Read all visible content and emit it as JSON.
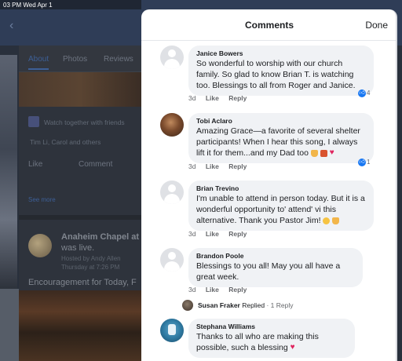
{
  "status_bar": {
    "time": "03 PM",
    "date": "Wed Apr 1"
  },
  "background": {
    "tabs": [
      "About",
      "Photos",
      "Reviews"
    ],
    "row1": "Watch together with friends",
    "row2": "Tim Li, Carol and others",
    "actions": {
      "like": "Like",
      "comment": "Comment"
    },
    "see_more": "See more",
    "post": {
      "title": "Anaheim Chapel at",
      "subtitle": "was live.",
      "meta1": "Hosted by Andy Allen",
      "meta2": "Thursday at 7:26 PM",
      "body": "Encouragement for Today, F"
    }
  },
  "sheet": {
    "title": "Comments",
    "done_label": "Done"
  },
  "comment_actions": {
    "like": "Like",
    "reply": "Reply"
  },
  "comments": [
    {
      "author": "Janice Bowers",
      "text": "So wonderful to worship with our church family. So glad to know Brian T. is watching too. Blessings to all from Roger and Janice.",
      "time": "3d",
      "reactions": "4"
    },
    {
      "author": "Tobi Aclaro",
      "text": "Amazing Grace—a favorite of several shelter participants! When I hear this song, I always lift it for them...and my Dad too",
      "time": "3d",
      "reactions": "1"
    },
    {
      "author": "Brian Trevino",
      "text": "I'm unable to attend in person today. But it is a wonderful opportunity to' attend' vi this alternative. Thank you Pastor Jim!",
      "time": "3d"
    },
    {
      "author": "Brandon Poole",
      "text": "Blessings to you all! May you all have a great week.",
      "time": "3d"
    },
    {
      "author": "Stephana Williams",
      "text": "Thanks to all who are making this possible, such a blessing"
    }
  ],
  "reply_summary": {
    "author": "Susan Fraker",
    "action": "Replied",
    "count": "· 1 Reply"
  },
  "colors": {
    "accent": "#1877f2",
    "bubble": "#f0f2f5",
    "heart": "#e0245e"
  }
}
